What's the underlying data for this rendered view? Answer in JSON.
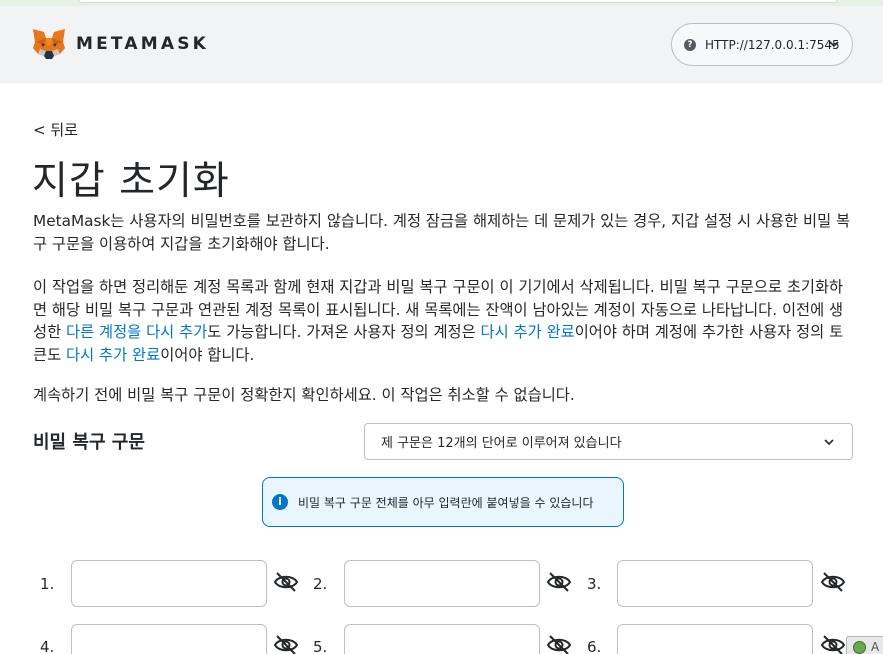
{
  "header": {
    "brand": "METAMASK",
    "network_label": "HTTP://127.0.0.1:7545",
    "network_icon_glyph": "?",
    "accent_color": "#0376c9"
  },
  "page": {
    "back_label": "< 뒤로",
    "title": "지갑 초기화",
    "p1": "MetaMask는 사용자의 비밀번호를 보관하지 않습니다. 계정 잠금을 해제하는 데 문제가 있는 경우, 지갑 설정 시 사용한 비밀 복구 구문을 이용하여 지갑을 초기화해야 합니다.",
    "p2_before": "이 작업을 하면 정리해둔 계정 목록과 함께 현재 지갑과 비밀 복구 구문이 이 기기에서 삭제됩니다. 비밀 복구 구문으로 초기화하면 해당 비밀 복구 구문과 연관된 계정 목록이 표시됩니다. 새 목록에는 잔액이 남아있는 계정이 자동으로 나타납니다. 이전에 생성한 ",
    "p2_link1": "다른 계정을 다시 추가",
    "p2_mid": "도 가능합니다. 가져온 사용자 정의 계정은 ",
    "p2_link2": "다시 추가 완료",
    "p2_mid2": "이어야 하며 계정에 추가한 사용자 정의 토큰도 ",
    "p2_link3": "다시 추가 완료",
    "p2_after": "이어야 합니다.",
    "p3": "계속하기 전에 비밀 복구 구문이 정확한지 확인하세요. 이 작업은 취소할 수 없습니다."
  },
  "srp": {
    "label": "비밀 복구 구문",
    "select_value": "제 구문은 12개의 단어로 이루어져 있습니다",
    "banner_text": "비밀 복구 구문 전체를 아무 입력란에 붙여넣을 수 있습니다",
    "banner_icon_glyph": "i",
    "words": [
      {
        "num": "1.",
        "value": ""
      },
      {
        "num": "2.",
        "value": ""
      },
      {
        "num": "3.",
        "value": ""
      },
      {
        "num": "4.",
        "value": ""
      },
      {
        "num": "5.",
        "value": ""
      },
      {
        "num": "6.",
        "value": ""
      }
    ]
  },
  "corner_widget": {
    "text": "A"
  }
}
